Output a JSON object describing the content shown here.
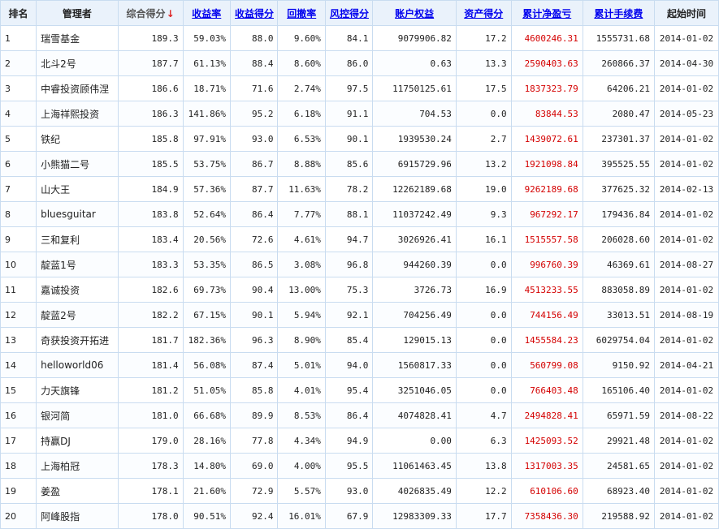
{
  "headers": {
    "rank": "排名",
    "manager": "管理者",
    "total_score": "综合得分",
    "total_score_sort_arrow": "↓",
    "return_rate": "收益率",
    "return_score": "收益得分",
    "drawdown": "回撤率",
    "risk_score": "风控得分",
    "equity": "账户权益",
    "asset_score": "资产得分",
    "net_pnl": "累计净盈亏",
    "fees": "累计手续费",
    "start_date": "起始时间"
  },
  "colors": {
    "header_bg": "#eaf2fb",
    "link": "#0000ee",
    "pnl": "#d40000",
    "border": "#c9dcf0",
    "sort_arrow": "#dd2222"
  },
  "rows": [
    [
      "1",
      "瑞雪基金",
      "189.3",
      "59.03%",
      "88.0",
      "9.60%",
      "84.1",
      "9079906.82",
      "17.2",
      "4600246.31",
      "1555731.68",
      "2014-01-02"
    ],
    [
      "2",
      "北斗2号",
      "187.7",
      "61.13%",
      "88.4",
      "8.60%",
      "86.0",
      "0.63",
      "13.3",
      "2590403.63",
      "260866.37",
      "2014-04-30"
    ],
    [
      "3",
      "中睿投资顾伟涅",
      "186.6",
      "18.71%",
      "71.6",
      "2.74%",
      "97.5",
      "11750125.61",
      "17.5",
      "1837323.79",
      "64206.21",
      "2014-01-02"
    ],
    [
      "4",
      "上海祥熙投资",
      "186.3",
      "141.86%",
      "95.2",
      "6.18%",
      "91.1",
      "704.53",
      "0.0",
      "83844.53",
      "2080.47",
      "2014-05-23"
    ],
    [
      "5",
      "铁纪",
      "185.8",
      "97.91%",
      "93.0",
      "6.53%",
      "90.1",
      "1939530.24",
      "2.7",
      "1439072.61",
      "237301.37",
      "2014-01-02"
    ],
    [
      "6",
      "小熊猫二号",
      "185.5",
      "53.75%",
      "86.7",
      "8.88%",
      "85.6",
      "6915729.96",
      "13.2",
      "1921098.84",
      "395525.55",
      "2014-01-02"
    ],
    [
      "7",
      "山大王",
      "184.9",
      "57.36%",
      "87.7",
      "11.63%",
      "78.2",
      "12262189.68",
      "19.0",
      "9262189.68",
      "377625.32",
      "2014-02-13"
    ],
    [
      "8",
      "bluesguitar",
      "183.8",
      "52.64%",
      "86.4",
      "7.77%",
      "88.1",
      "11037242.49",
      "9.3",
      "967292.17",
      "179436.84",
      "2014-01-02"
    ],
    [
      "9",
      "三和复利",
      "183.4",
      "20.56%",
      "72.6",
      "4.61%",
      "94.7",
      "3026926.41",
      "16.1",
      "1515557.58",
      "206028.60",
      "2014-01-02"
    ],
    [
      "10",
      "靛蓝1号",
      "183.3",
      "53.35%",
      "86.5",
      "3.08%",
      "96.8",
      "944260.39",
      "0.0",
      "996760.39",
      "46369.61",
      "2014-08-27"
    ],
    [
      "11",
      "嘉诚投资",
      "182.6",
      "69.73%",
      "90.4",
      "13.00%",
      "75.3",
      "3726.73",
      "16.9",
      "4513233.55",
      "883058.89",
      "2014-01-02"
    ],
    [
      "12",
      "靛蓝2号",
      "182.2",
      "67.15%",
      "90.1",
      "5.94%",
      "92.1",
      "704256.49",
      "0.0",
      "744156.49",
      "33013.51",
      "2014-08-19"
    ],
    [
      "13",
      "奇获投资开拓进",
      "181.7",
      "182.36%",
      "96.3",
      "8.90%",
      "85.4",
      "129015.13",
      "0.0",
      "1455584.23",
      "6029754.04",
      "2014-01-02"
    ],
    [
      "14",
      "helloworld06",
      "181.4",
      "56.08%",
      "87.4",
      "5.01%",
      "94.0",
      "1560817.33",
      "0.0",
      "560799.08",
      "9150.92",
      "2014-04-21"
    ],
    [
      "15",
      "力天旗锋",
      "181.2",
      "51.05%",
      "85.8",
      "4.01%",
      "95.4",
      "3251046.05",
      "0.0",
      "766403.48",
      "165106.40",
      "2014-01-02"
    ],
    [
      "16",
      "银河简",
      "181.0",
      "66.68%",
      "89.9",
      "8.53%",
      "86.4",
      "4074828.41",
      "4.7",
      "2494828.41",
      "65971.59",
      "2014-08-22"
    ],
    [
      "17",
      "持赢DJ",
      "179.0",
      "28.16%",
      "77.8",
      "4.34%",
      "94.9",
      "0.00",
      "6.3",
      "1425093.52",
      "29921.48",
      "2014-01-02"
    ],
    [
      "18",
      "上海柏冠",
      "178.3",
      "14.80%",
      "69.0",
      "4.00%",
      "95.5",
      "11061463.45",
      "13.8",
      "1317003.35",
      "24581.65",
      "2014-01-02"
    ],
    [
      "19",
      "姜盈",
      "178.1",
      "21.60%",
      "72.9",
      "5.57%",
      "93.0",
      "4026835.49",
      "12.2",
      "610106.60",
      "68923.40",
      "2014-01-02"
    ],
    [
      "20",
      "阿峰股指",
      "178.0",
      "90.51%",
      "92.4",
      "16.01%",
      "67.9",
      "12983309.33",
      "17.7",
      "7358436.30",
      "219588.92",
      "2014-01-02"
    ]
  ]
}
